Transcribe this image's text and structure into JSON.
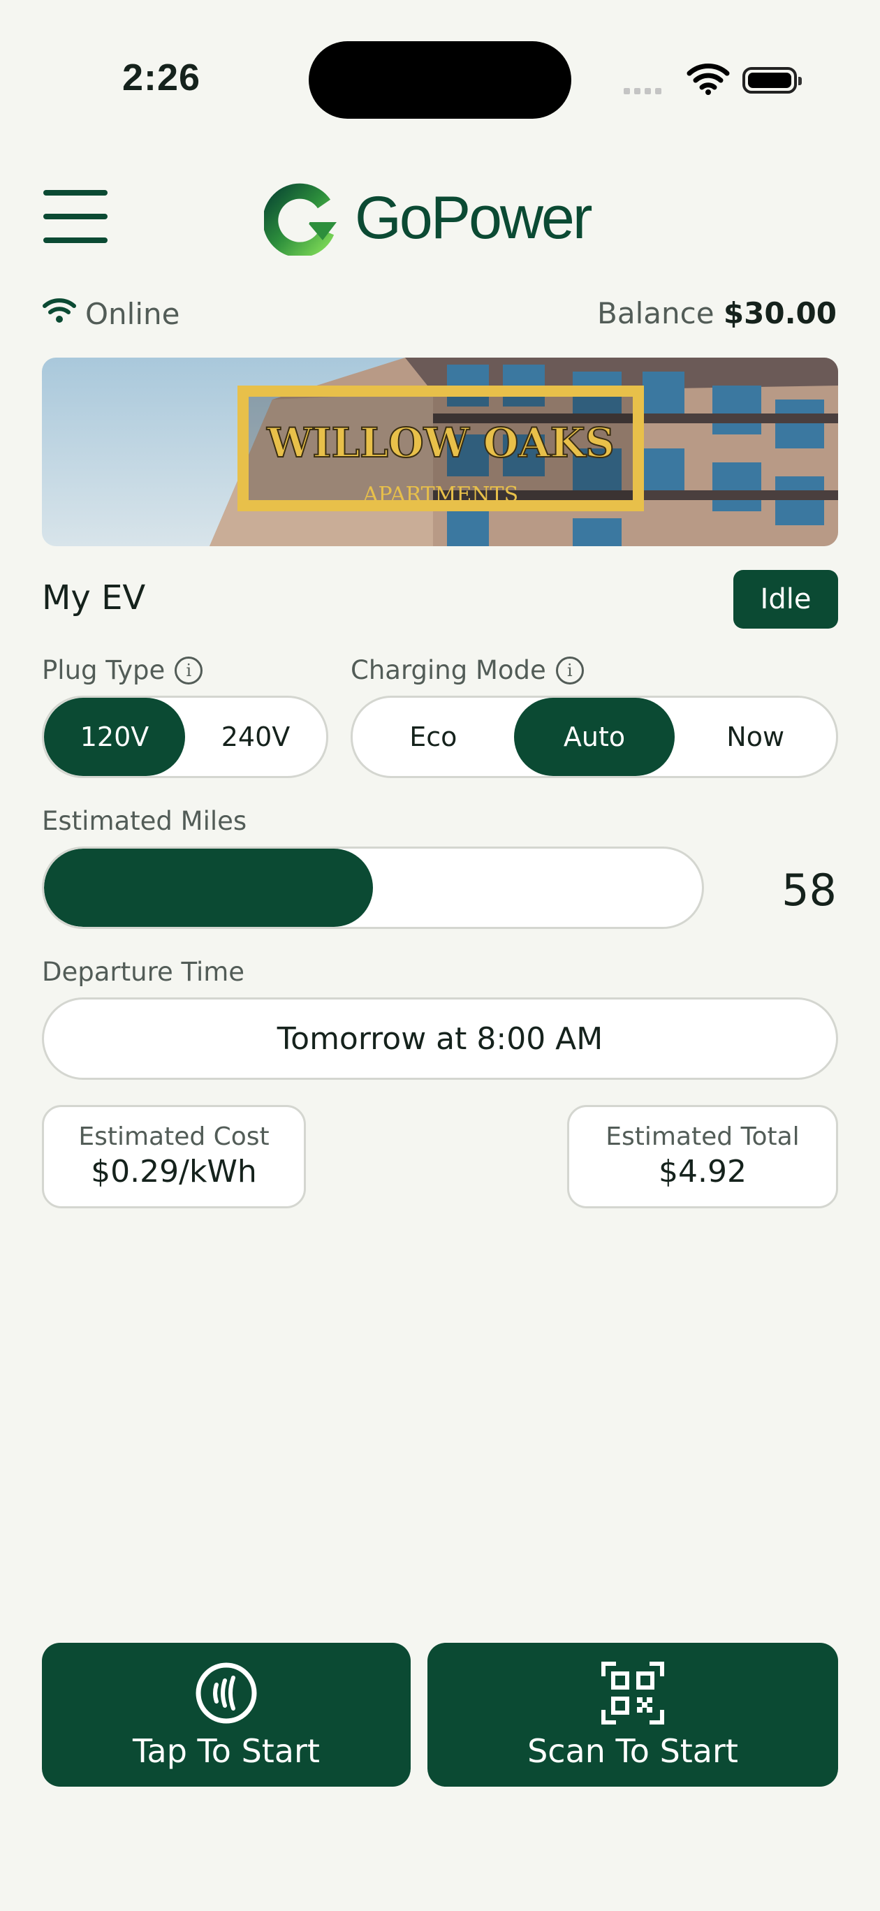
{
  "status_bar": {
    "time": "2:26"
  },
  "header": {
    "brand": "GoPower"
  },
  "info_row": {
    "connection": "Online",
    "balance_label": "Balance",
    "balance_value": "$30.00"
  },
  "banner": {
    "title": "WILLOW OAKS",
    "subtitle": "APARTMENTS"
  },
  "vehicle": {
    "name": "My EV",
    "status": "Idle"
  },
  "plug_type": {
    "label": "Plug Type",
    "options": [
      "120V",
      "240V"
    ],
    "selected": "120V"
  },
  "charging_mode": {
    "label": "Charging Mode",
    "options": [
      "Eco",
      "Auto",
      "Now"
    ],
    "selected": "Auto"
  },
  "estimated_miles": {
    "label": "Estimated Miles",
    "value": "58",
    "fill_fraction": 0.5
  },
  "departure": {
    "label": "Departure Time",
    "value": "Tomorrow at 8:00 AM"
  },
  "estimates": {
    "cost_label": "Estimated Cost",
    "cost_value": "$0.29/kWh",
    "total_label": "Estimated Total",
    "total_value": "$4.92"
  },
  "actions": {
    "tap_label": "Tap To Start",
    "scan_label": "Scan To Start"
  },
  "colors": {
    "primary": "#0b4a33",
    "accent_green": "#7ed957",
    "banner_gold": "#e8c04a",
    "background": "#f5f6f1"
  },
  "icons": [
    "wifi-icon",
    "battery-icon",
    "menu-icon",
    "gopower-logo-icon",
    "info-icon",
    "nfc-tap-icon",
    "qr-code-icon"
  ]
}
